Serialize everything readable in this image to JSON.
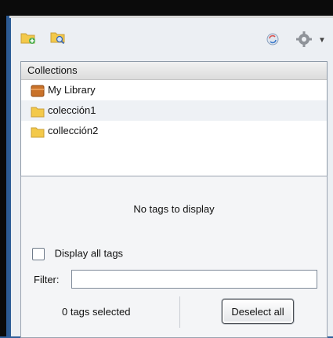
{
  "toolbar": {
    "new_collection_icon": "folder-add-icon",
    "new_saved_search_icon": "saved-search-icon",
    "sync_icon": "sync-icon",
    "actions_icon": "gear-icon"
  },
  "collections": {
    "header": "Collections",
    "items": [
      {
        "label": "My Library",
        "icon": "library-icon"
      },
      {
        "label": "colección1",
        "icon": "folder-icon"
      },
      {
        "label": "collección2",
        "icon": "folder-icon"
      }
    ]
  },
  "tag_selector": {
    "empty_message": "No tags to display",
    "display_all_label": "Display all tags",
    "filter_label": "Filter:",
    "filter_value": "",
    "selected_count_text": "0 tags selected",
    "deselect_all_label": "Deselect all"
  },
  "colors": {
    "frame_blue": "#2e5e98",
    "panel_bg": "#eceff3",
    "folder_yellow": "#f3c94a",
    "library_orange": "#c9722a"
  }
}
